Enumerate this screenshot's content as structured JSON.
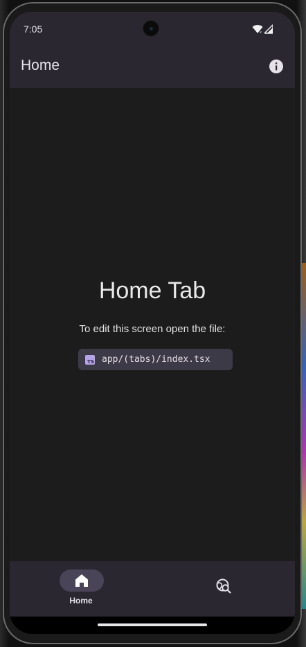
{
  "status_bar": {
    "time": "7:05",
    "icons": [
      "wifi-icon",
      "signal-icon"
    ]
  },
  "app_bar": {
    "title": "Home",
    "action_icon": "info-icon"
  },
  "main": {
    "heading": "Home Tab",
    "subtext": "To edit this screen open the file:",
    "file_icon_text": "TS",
    "file_path": "app/(tabs)/index.tsx"
  },
  "tab_bar": {
    "tabs": [
      {
        "label": "Home",
        "icon": "home-icon",
        "selected": true
      },
      {
        "label": "",
        "icon": "explore-icon",
        "selected": false
      }
    ]
  },
  "colors": {
    "bar_background": "#2a2731",
    "content_background": "#1c1c1c",
    "active_pill": "#4a4458",
    "chip_background": "#3d3a47",
    "text": "#e6e1e9"
  }
}
